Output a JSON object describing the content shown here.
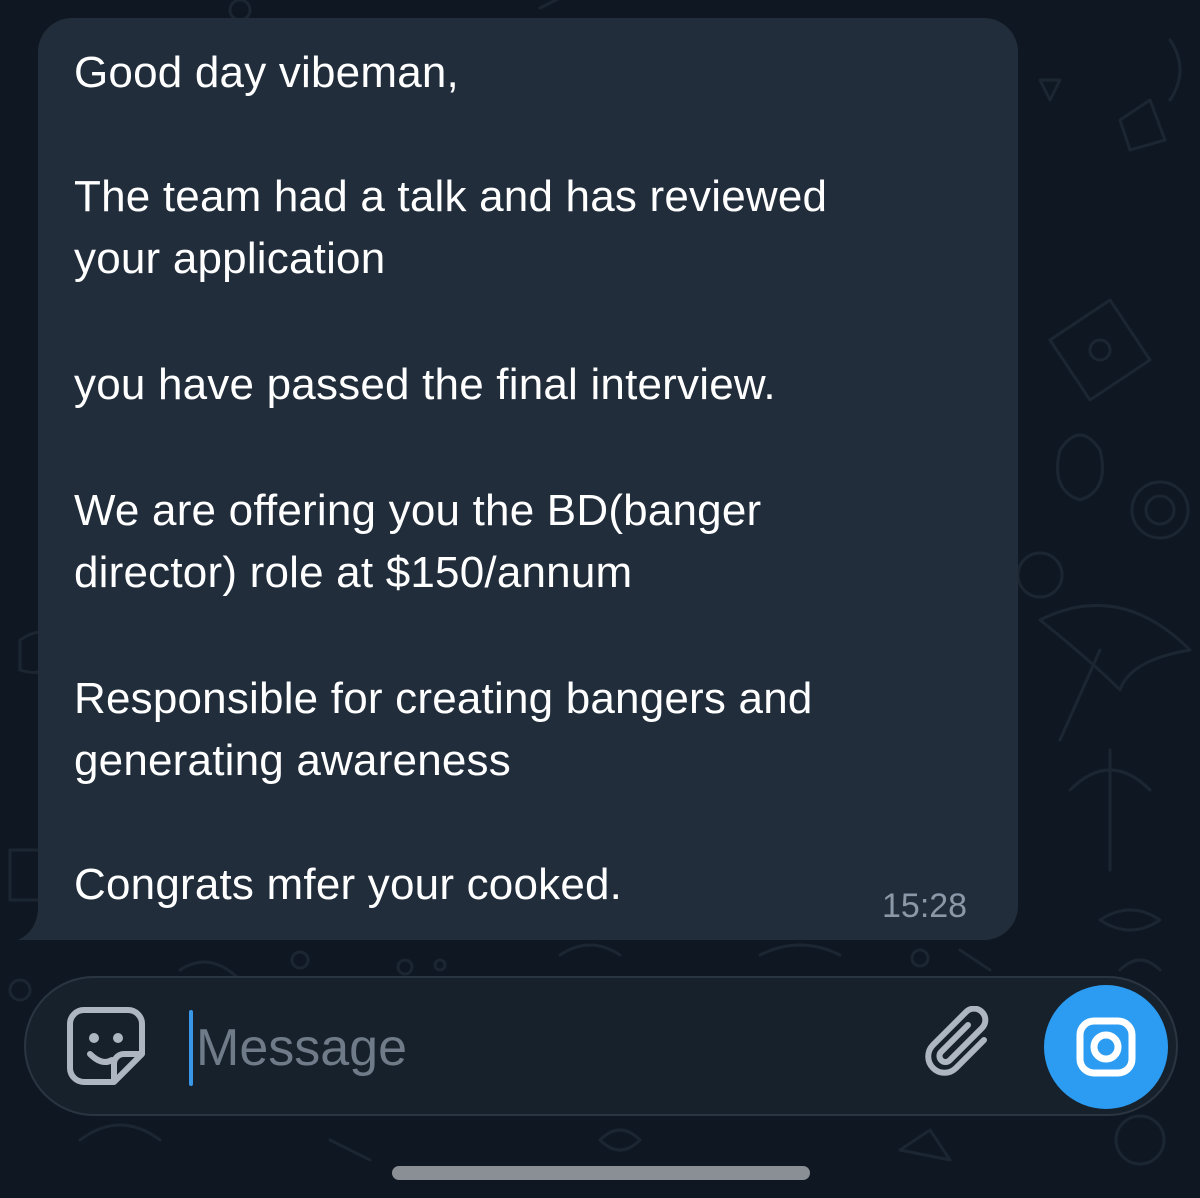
{
  "message": {
    "lines": [
      "Good day vibeman,",
      "",
      "The team had a talk and has reviewed",
      "your application",
      "",
      "you have passed the final interview.",
      "",
      "We are offering you the BD(banger",
      "director) role at $150/annum",
      "",
      "Responsible for creating bangers and",
      "generating awareness",
      "",
      "Congrats mfer your cooked."
    ],
    "time": "15:28"
  },
  "composer": {
    "placeholder": "Message",
    "value": ""
  },
  "icons": {
    "sticker": "sticker-emoji-icon",
    "attach": "paperclip-icon",
    "camera": "camera-icon"
  },
  "colors": {
    "background": "#0e1621",
    "bubble": "#212d3b",
    "accent": "#2b9cf2",
    "timestamp": "#8a98a8"
  }
}
